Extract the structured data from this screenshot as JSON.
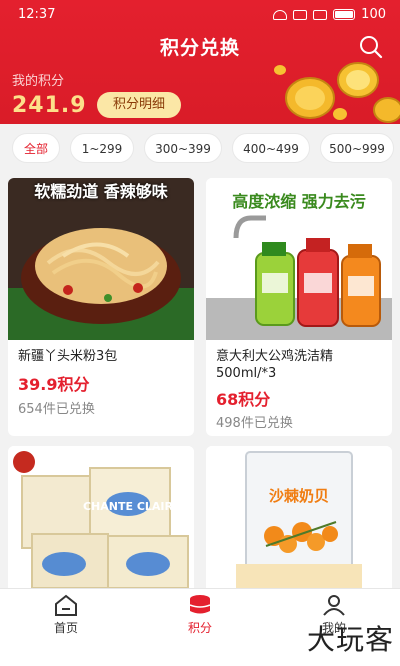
{
  "status": {
    "time": "12:37",
    "battery": "100"
  },
  "header": {
    "title": "积分兑换",
    "points_label": "我的积分",
    "points_value": "241.9",
    "detail_button": "积分明细"
  },
  "filters": [
    {
      "label": "全部",
      "active": true
    },
    {
      "label": "1~299",
      "active": false
    },
    {
      "label": "300~399",
      "active": false
    },
    {
      "label": "400~499",
      "active": false
    },
    {
      "label": "500~999",
      "active": false
    }
  ],
  "products": [
    {
      "name": "新疆丫头米粉3包",
      "price": "39.9积分",
      "count": "654件已兑换",
      "banner": "软糯劲道  香辣够味"
    },
    {
      "name": " 意大利大公鸡洗洁精500ml/*3",
      "price": "68积分",
      "count": "498件已兑换",
      "banner": "高度浓缩  强力去污"
    },
    {
      "name": "",
      "price": "",
      "count": "",
      "banner": "CHANTE CLAIR"
    },
    {
      "name": "",
      "price": "",
      "count": "",
      "banner": "沙棘奶贝"
    }
  ],
  "tabbar": [
    {
      "label": "首页",
      "icon": "home-icon",
      "active": false
    },
    {
      "label": "积分",
      "icon": "points-icon",
      "active": true
    },
    {
      "label": "我的",
      "icon": "profile-icon",
      "active": false
    }
  ],
  "watermark": "大玩客",
  "colors": {
    "primary": "#e4202e",
    "gold": "#fde08a"
  }
}
